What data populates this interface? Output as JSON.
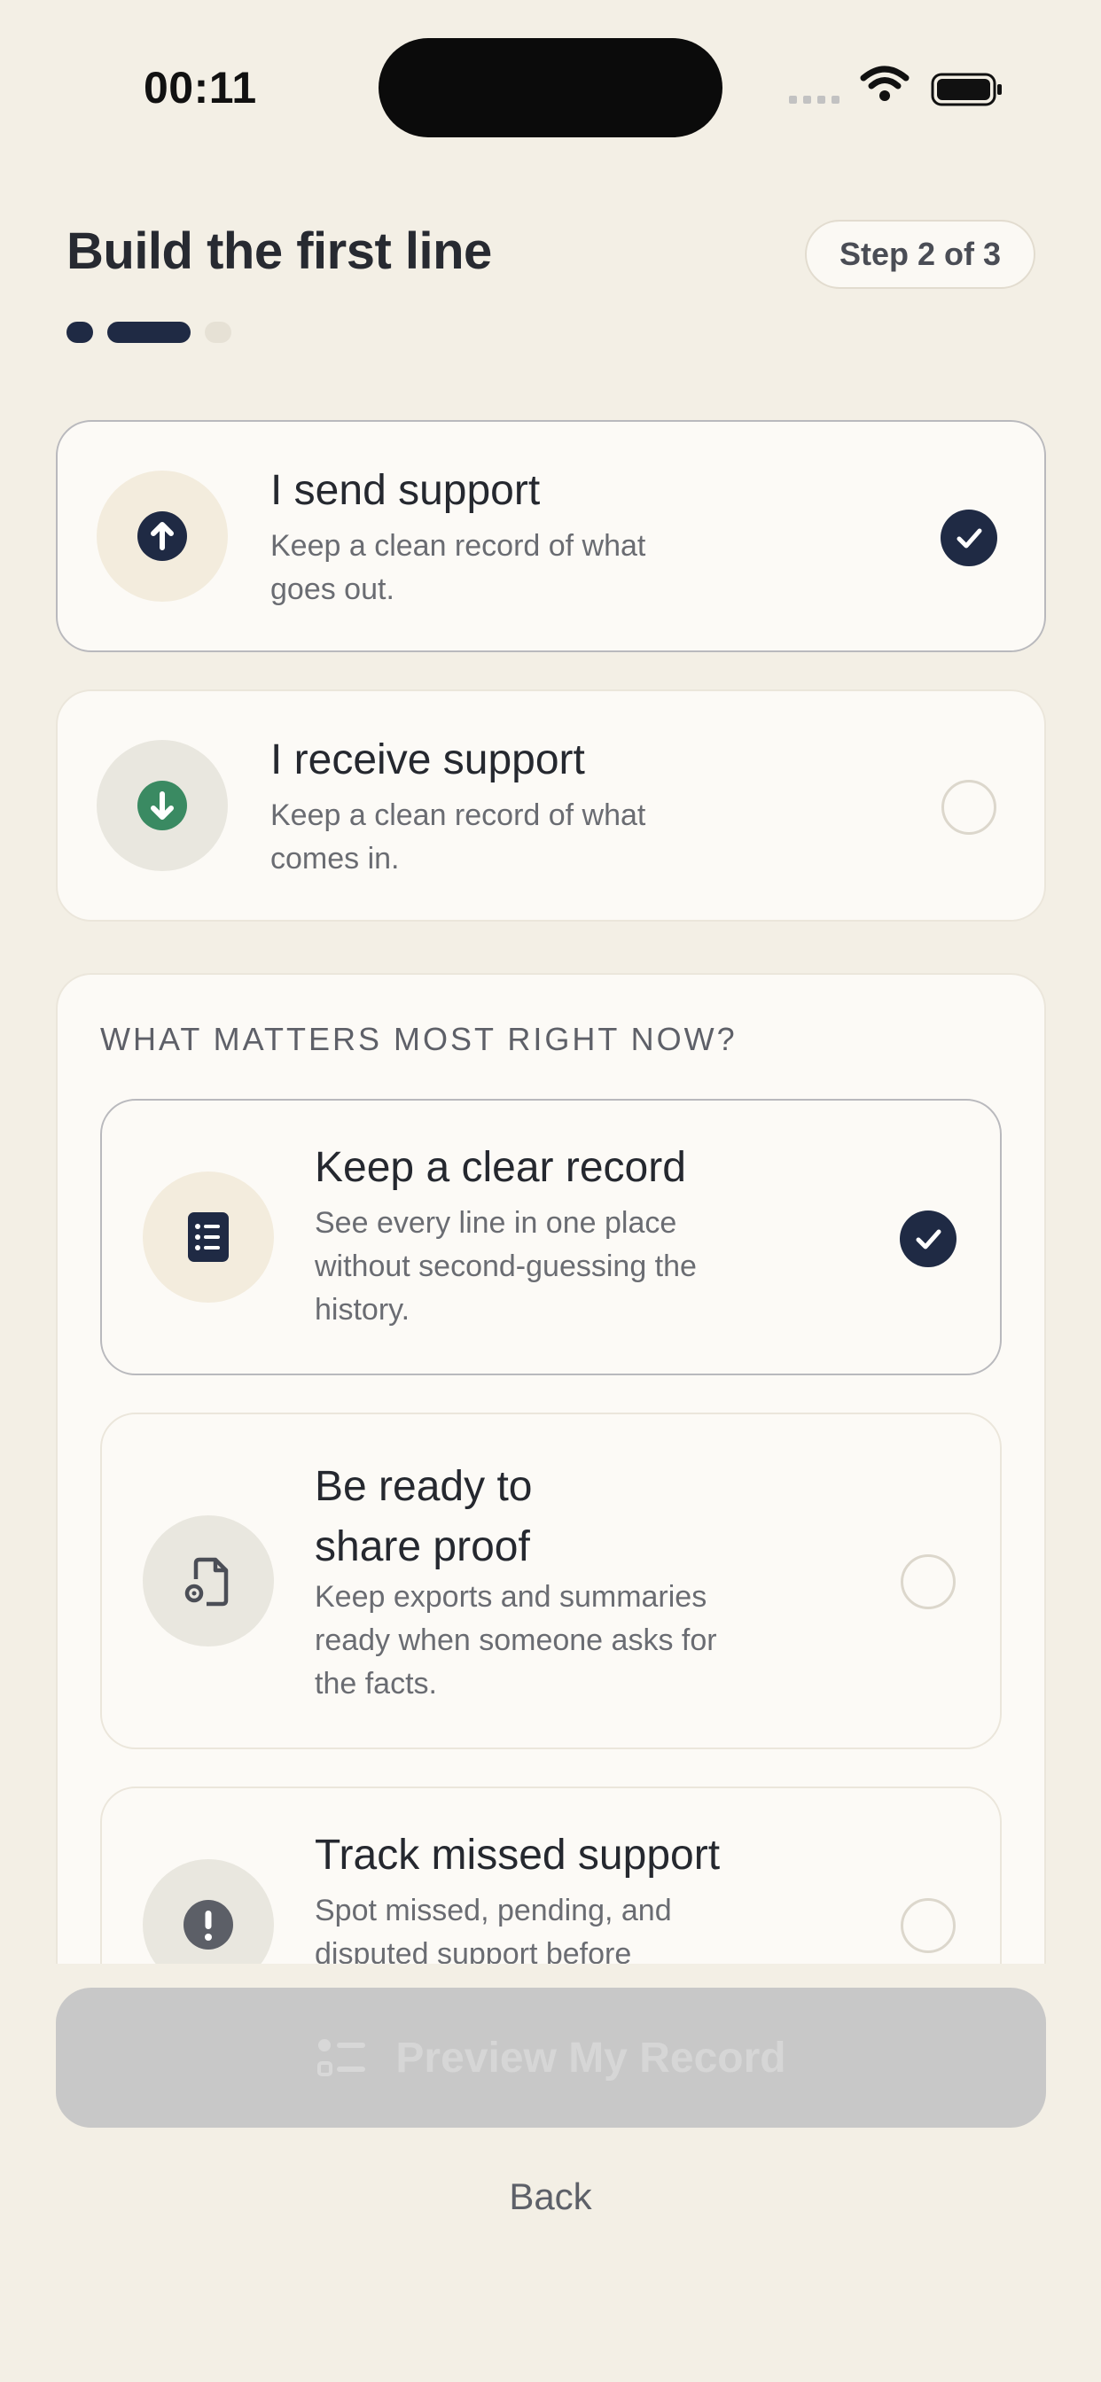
{
  "status_bar": {
    "time": "00:11"
  },
  "header": {
    "title": "Build the first line",
    "step": "Step 2 of 3",
    "progress_step": 2,
    "progress_total": 3
  },
  "roles": [
    {
      "title": "I send support",
      "desc_line1": "Keep a clean record of what",
      "desc_line2": "goes out.",
      "icon": "arrow-up-icon",
      "selected": true
    },
    {
      "title": "I receive support",
      "desc_line1": "Keep a clean record of what",
      "desc_line2": "comes in.",
      "icon": "arrow-down-icon",
      "selected": false
    }
  ],
  "priorities": {
    "label": "WHAT MATTERS MOST RIGHT NOW?",
    "options": [
      {
        "title_line1": "Keep a clear record",
        "desc_lines": [
          "See every line in one place",
          "without second-guessing the",
          "history."
        ],
        "icon": "list-document-icon",
        "selected": true
      },
      {
        "title_line1": "Be ready to",
        "title_line2": "share proof",
        "desc_lines": [
          "Keep exports and summaries",
          "ready when someone asks for",
          "the facts."
        ],
        "icon": "file-gear-icon",
        "selected": false
      },
      {
        "title_line1": "Track missed support",
        "desc_lines": [
          "Spot missed, pending, and",
          "disputed support before"
        ],
        "icon": "alert-icon",
        "selected": false
      }
    ]
  },
  "cta": {
    "label": "Preview My Record",
    "icon": "checklist-icon",
    "enabled": false
  },
  "back": {
    "label": "Back"
  },
  "colors": {
    "background": "#f3efe5",
    "accent": "#1f2a44",
    "receive_green": "#3a8a62",
    "card": "#fcfaf6"
  }
}
